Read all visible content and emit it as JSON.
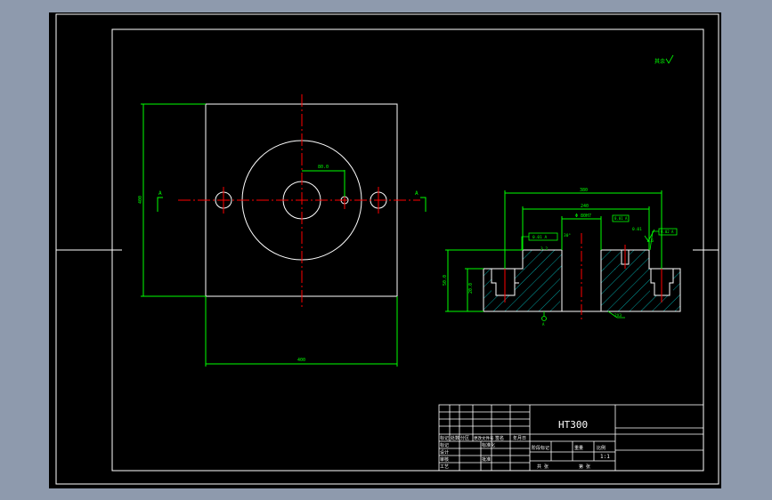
{
  "drawing": {
    "material": "HT300",
    "roughness_note": "其余",
    "section_label": "A",
    "scale": "1:1",
    "colors": {
      "background": "#000000",
      "frame": "#ffffff",
      "dimension": "#00ff00",
      "centerline": "#ff0000",
      "hatch": "#00c8c8",
      "window": "#8e9aad"
    }
  },
  "dimensions": {
    "top_view": {
      "width": "400",
      "height": "400",
      "hole_offset": "80.0"
    },
    "section_view": {
      "overall_length": "380",
      "inner_length": "240",
      "bore": "Φ 80H7",
      "feature_tolerance": "0.01",
      "overall_height": "50.0",
      "step_height": "20.0",
      "angle": "30°",
      "chamfer": "2X3",
      "roughness_1": "1.6",
      "roughness_2": "3.2",
      "datum": "A",
      "tolerance_frame_left": "0.01 A",
      "tolerance_frame_mid": "0.01 A",
      "tolerance_frame_right": "0.02 A"
    }
  },
  "title_block": {
    "rows_left": [
      "标记",
      "设计",
      "审核",
      "工艺"
    ],
    "header_cells": [
      "标记",
      "处数",
      "分区",
      "更改文件号",
      "签名",
      "年月日"
    ],
    "mid_cells": [
      "标准化",
      "批准"
    ],
    "stage_labels": [
      "阶段标记",
      "重量",
      "比例"
    ],
    "sheet_labels": [
      "共 张",
      "第 张"
    ]
  }
}
